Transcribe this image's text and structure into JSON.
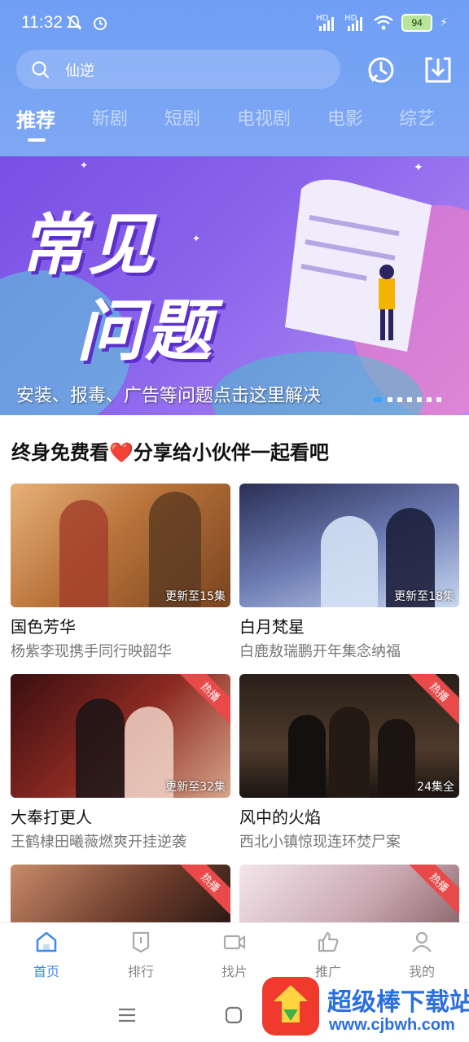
{
  "status_bar": {
    "time": "11:32",
    "signal1_label": "HD",
    "signal2_label": "HD",
    "battery": "94"
  },
  "header": {
    "search_value": "仙逆",
    "tabs": [
      {
        "label": "推荐"
      },
      {
        "label": "新剧"
      },
      {
        "label": "短剧"
      },
      {
        "label": "电视剧"
      },
      {
        "label": "电影"
      },
      {
        "label": "综艺"
      }
    ]
  },
  "banner": {
    "title_line1": "常见",
    "title_line2": "问题",
    "caption": "安装、报毒、广告等问题点击这里解决"
  },
  "section": {
    "title": "终身免费看❤️分享给小伙伴一起看吧"
  },
  "cards": [
    {
      "title": "国色芳华",
      "subtitle": "杨紫李现携手同行映韶华",
      "episode": "更新至15集"
    },
    {
      "title": "白月梵星",
      "subtitle": "白鹿敖瑞鹏开年集念纳福",
      "episode": "更新至18集"
    },
    {
      "title": "大奉打更人",
      "subtitle": "王鹤棣田曦薇燃爽开挂逆袭",
      "episode": "更新至32集",
      "badge": "热播"
    },
    {
      "title": "风中的火焰",
      "subtitle": "西北小镇惊现连环焚尸案",
      "episode": "24集全",
      "badge": "热播"
    },
    {
      "badge": "热播"
    },
    {
      "badge": "热播"
    }
  ],
  "bottom_nav": [
    {
      "label": "首页",
      "icon": "home-icon"
    },
    {
      "label": "排行",
      "icon": "ranking-icon"
    },
    {
      "label": "找片",
      "icon": "video-camera-icon"
    },
    {
      "label": "推广",
      "icon": "thumbs-up-icon"
    },
    {
      "label": "我的",
      "icon": "person-icon"
    }
  ],
  "watermark": {
    "name": "超级棒下载站",
    "url": "www.cjbwh.com"
  },
  "colors": {
    "header_blue": "#7fa8f3",
    "accent_blue": "#3e8bf0",
    "hot_red": "#e84a4a"
  }
}
